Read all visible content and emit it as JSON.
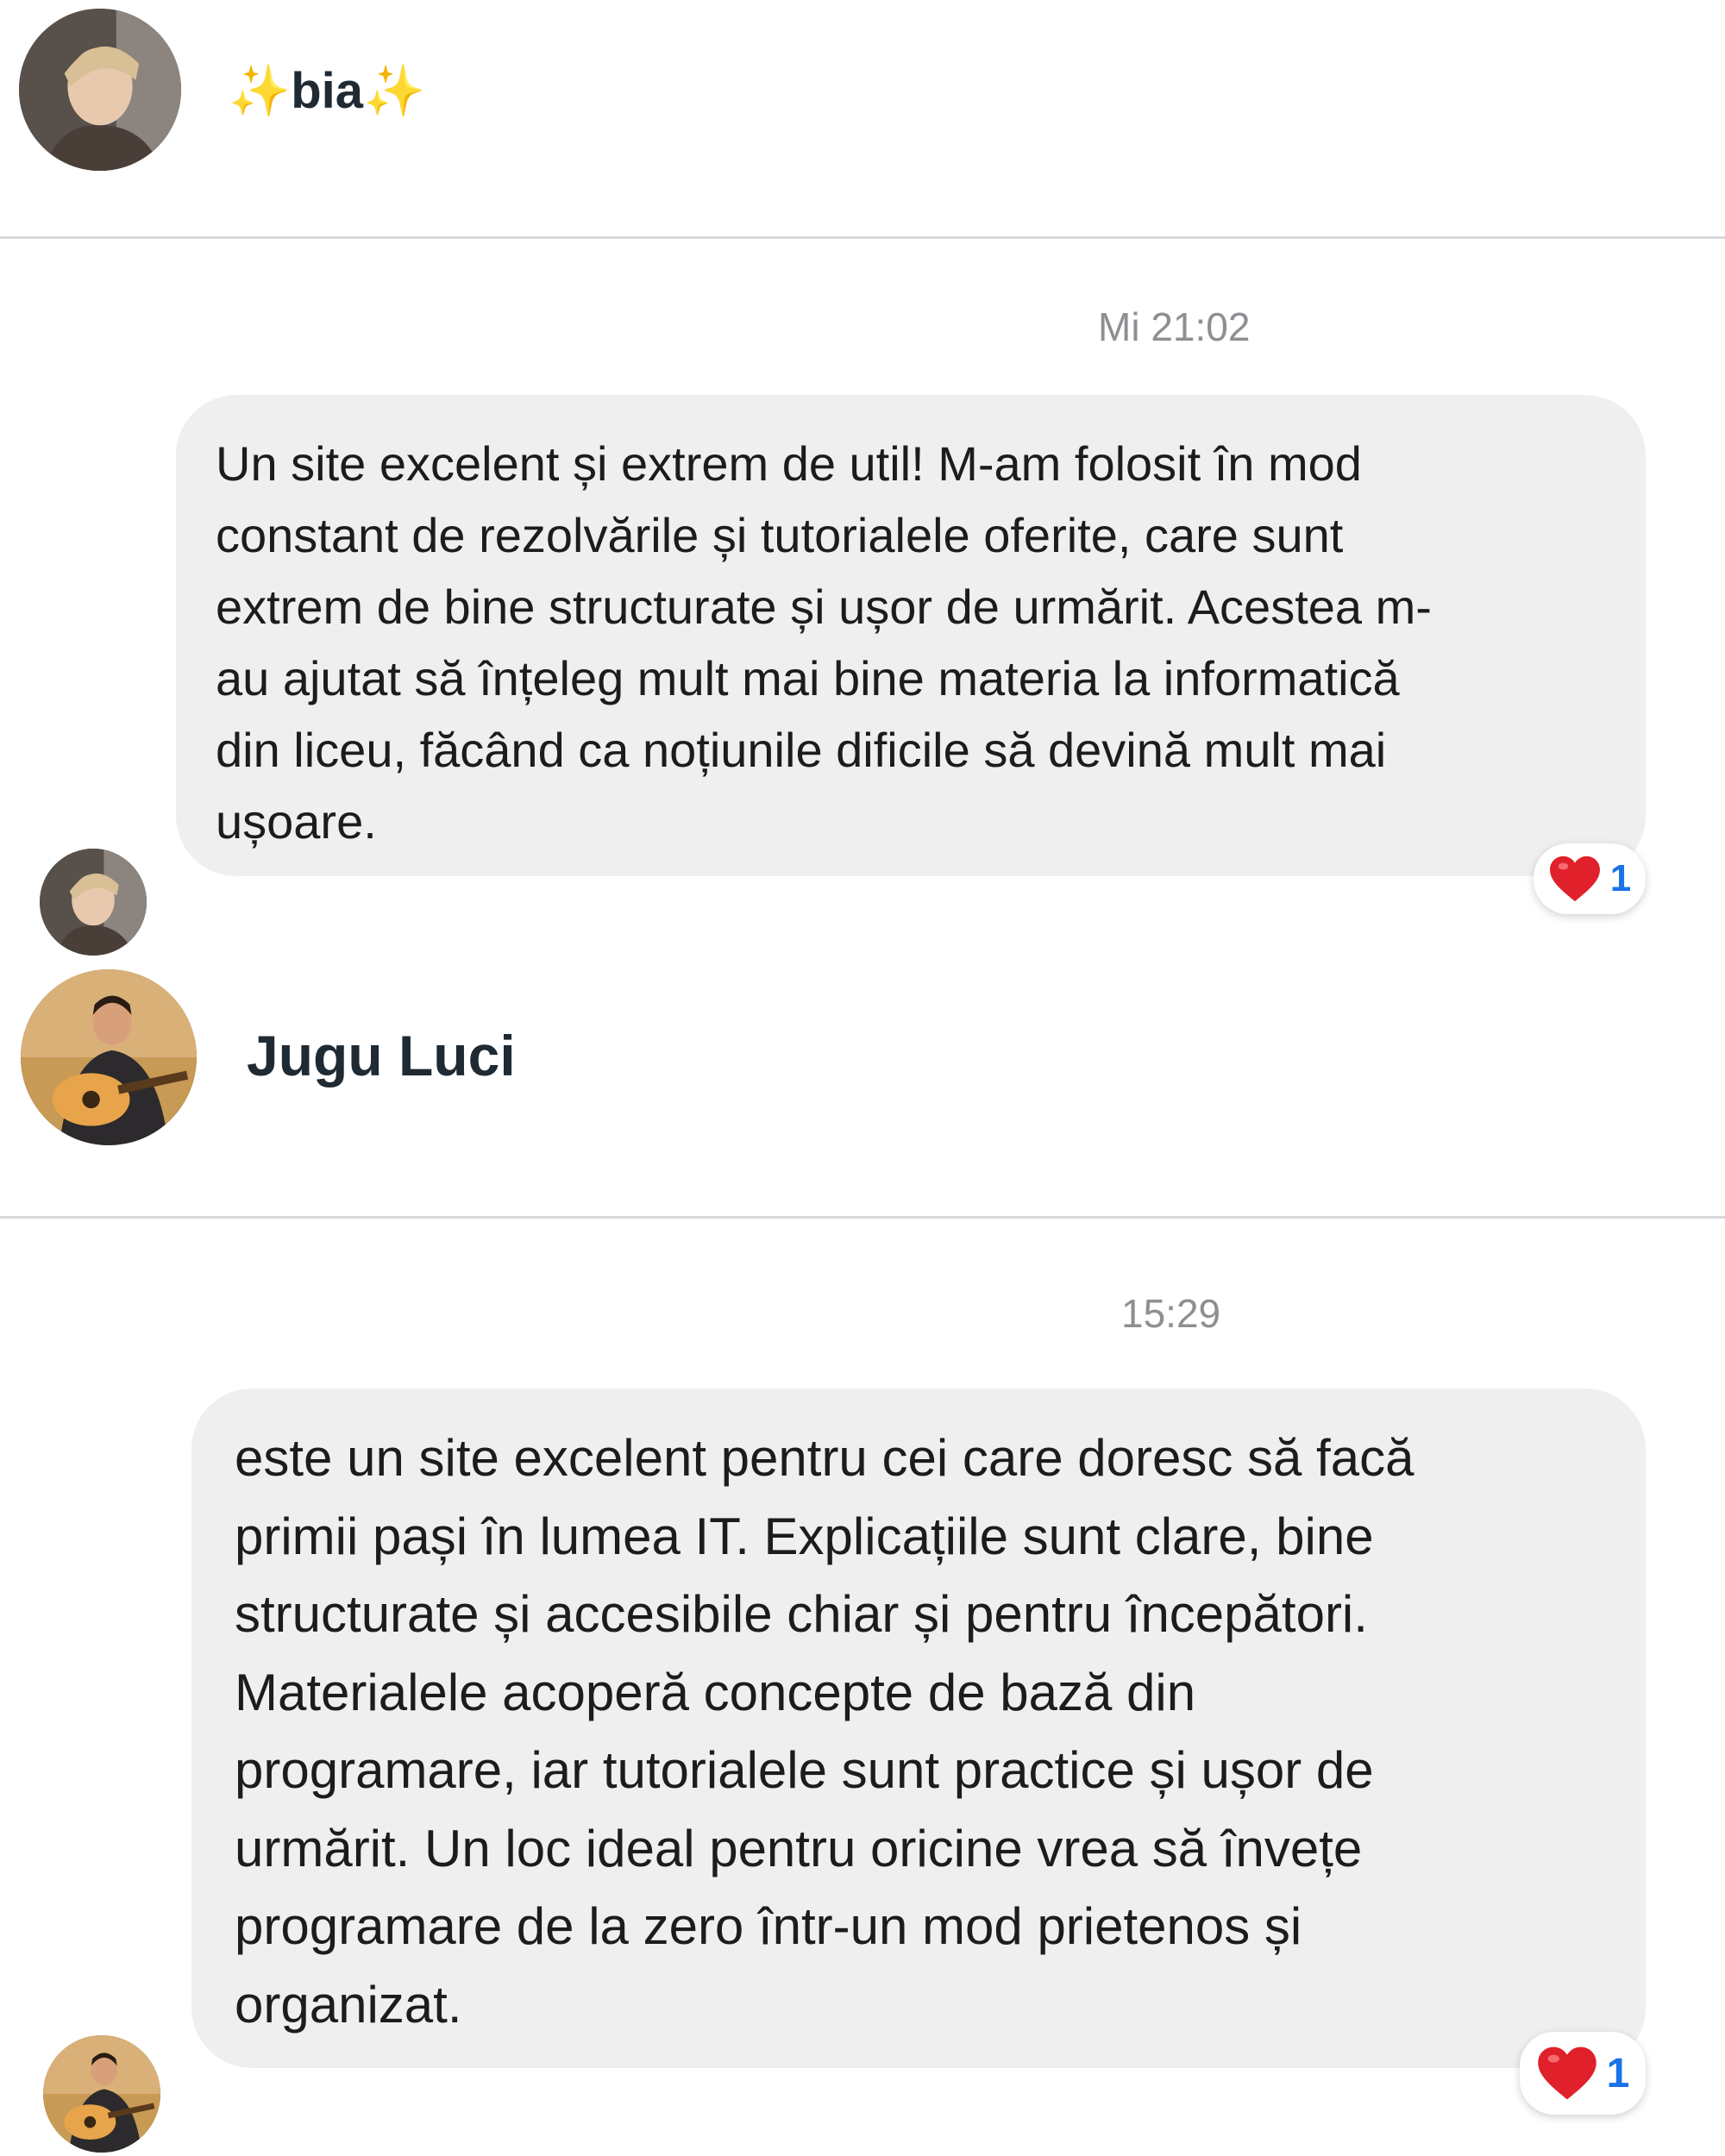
{
  "colors": {
    "bubble_bg": "#efefef",
    "timestamp": "#8e8e93",
    "name": "#1f2a33",
    "reaction_count": "#1a73e8",
    "heart": "#e0202a",
    "sparkle": "#f5c518"
  },
  "conversations": [
    {
      "contact": {
        "sparkle_left": "✨",
        "name": "bia",
        "sparkle_right": "✨",
        "avatar_icon": "user-photo-avatar"
      },
      "timestamp": "Mi 21:02",
      "message": {
        "text": "Un site excelent și extrem de util! M-am folosit în mod\nconstant de rezolvările și tutorialele oferite, care sunt\nextrem de bine structurate și ușor de urmărit. Acestea m-\nau ajutat să înțeleg mult mai bine materia la informatică\ndin liceu, făcând ca noțiunile dificile să devină mult mai\nușoare.",
        "reaction_icon": "heart-icon",
        "reaction_count": "1"
      }
    },
    {
      "contact": {
        "name": "Jugu Luci",
        "avatar_icon": "user-photo-avatar-guitar"
      },
      "timestamp": "15:29",
      "message": {
        "text": "este un site excelent pentru cei care doresc să facă\nprimii pași în lumea IT. Explicațiile sunt clare, bine\nstructurate și accesibile chiar și pentru începători.\nMaterialele acoperă concepte de bază din\nprogramare, iar tutorialele sunt practice și ușor de\nurmărit. Un loc ideal pentru oricine vrea să învețe\nprogramare de la zero într-un mod prietenos și\norganizat.",
        "reaction_icon": "heart-icon",
        "reaction_count": "1"
      }
    }
  ]
}
